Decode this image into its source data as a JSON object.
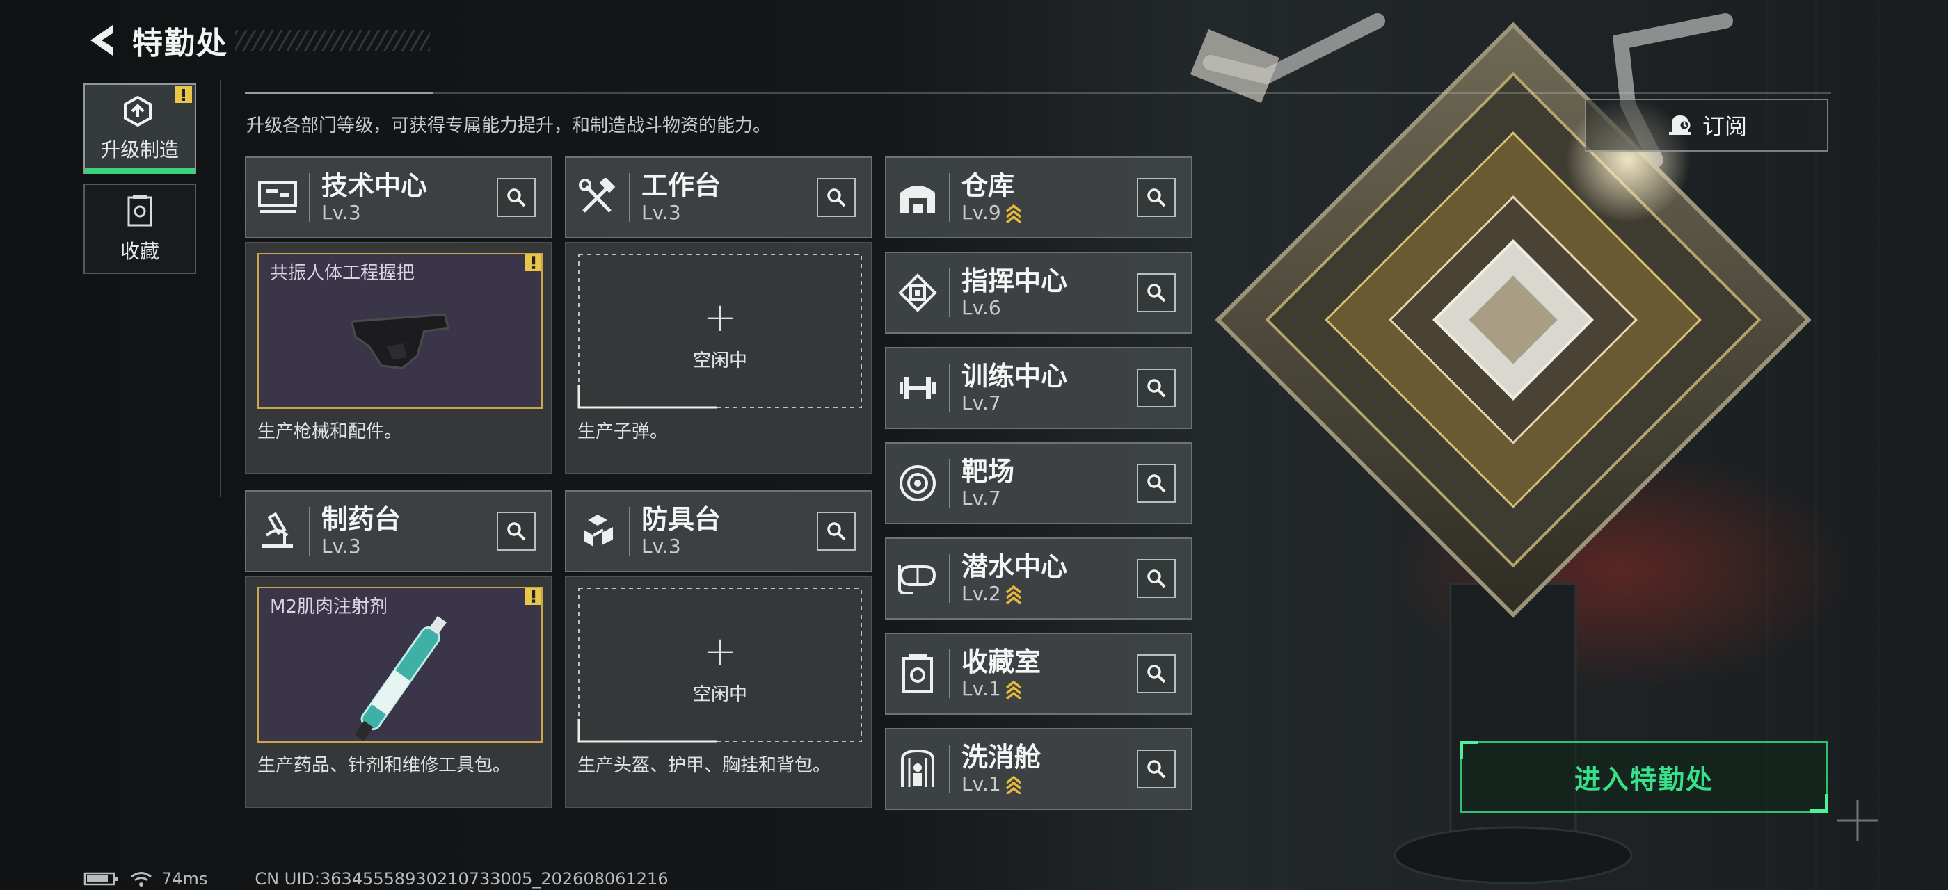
{
  "header": {
    "title": "特勤处"
  },
  "nav": {
    "items": [
      {
        "label": "升级制造",
        "icon": "upgrade-cube-icon",
        "active": true,
        "warning": true
      },
      {
        "label": "收藏",
        "icon": "collection-icon",
        "active": false,
        "warning": false
      }
    ]
  },
  "description": "升级各部门等级，可获得专属能力提升，和制造战斗物资的能力。",
  "facilities": [
    {
      "name": "技术中心",
      "level": "Lv.3",
      "icon": "tech-center-icon",
      "status": "producing",
      "product": "共振人体工程握把",
      "product_icon": "grip-item-icon",
      "desc": "生产枪械和配件。"
    },
    {
      "name": "工作台",
      "level": "Lv.3",
      "icon": "hammer-wrench-icon",
      "status": "idle",
      "idle_label": "空闲中",
      "desc": "生产子弹。"
    },
    {
      "name": "制药台",
      "level": "Lv.3",
      "icon": "microscope-icon",
      "status": "producing",
      "product": "M2肌肉注射剂",
      "product_icon": "injector-item-icon",
      "desc": "生产药品、针剂和维修工具包。"
    },
    {
      "name": "防具台",
      "level": "Lv.3",
      "icon": "armor-blocks-icon",
      "status": "idle",
      "idle_label": "空闲中",
      "desc": "生产头盔、护甲、胸挂和背包。"
    }
  ],
  "plus_symbol": "+",
  "departments": [
    {
      "name": "仓库",
      "level": "Lv.9",
      "icon": "warehouse-icon",
      "upgradable": true
    },
    {
      "name": "指挥中心",
      "level": "Lv.6",
      "icon": "command-chip-icon",
      "upgradable": false
    },
    {
      "name": "训练中心",
      "level": "Lv.7",
      "icon": "dumbbell-icon",
      "upgradable": false
    },
    {
      "name": "靶场",
      "level": "Lv.7",
      "icon": "target-icon",
      "upgradable": false
    },
    {
      "name": "潜水中心",
      "level": "Lv.2",
      "icon": "diving-mask-icon",
      "upgradable": true
    },
    {
      "name": "收藏室",
      "level": "Lv.1",
      "icon": "collection-room-icon",
      "upgradable": true
    },
    {
      "name": "洗消舱",
      "level": "Lv.1",
      "icon": "decon-cabin-icon",
      "upgradable": true
    }
  ],
  "subscribe": {
    "label": "订阅",
    "icon": "subscribe-bell-icon"
  },
  "enter": {
    "label": "进入特勤处"
  },
  "status": {
    "ping": "74ms",
    "uid": "CN UID:36345558930210733005_202608061216"
  },
  "colors": {
    "accent_green": "#38e08a",
    "warning_yellow": "#e8c64a",
    "product_border": "#c8a84a",
    "upgrade_chevron": "#e6b93c"
  }
}
